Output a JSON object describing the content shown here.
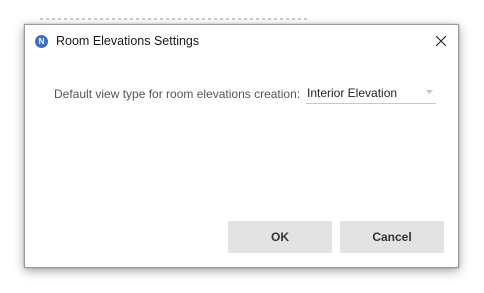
{
  "dialog": {
    "title": "Room Elevations Settings",
    "app_icon_letter": "N",
    "app_icon_name": "app-logo-icon",
    "close_icon_name": "close-icon",
    "accent_color": "#3f6fc4"
  },
  "setting": {
    "label": "Default view type for room elevations creation:",
    "selected_value": "Interior Elevation"
  },
  "buttons": {
    "ok_label": "OK",
    "cancel_label": "Cancel"
  }
}
